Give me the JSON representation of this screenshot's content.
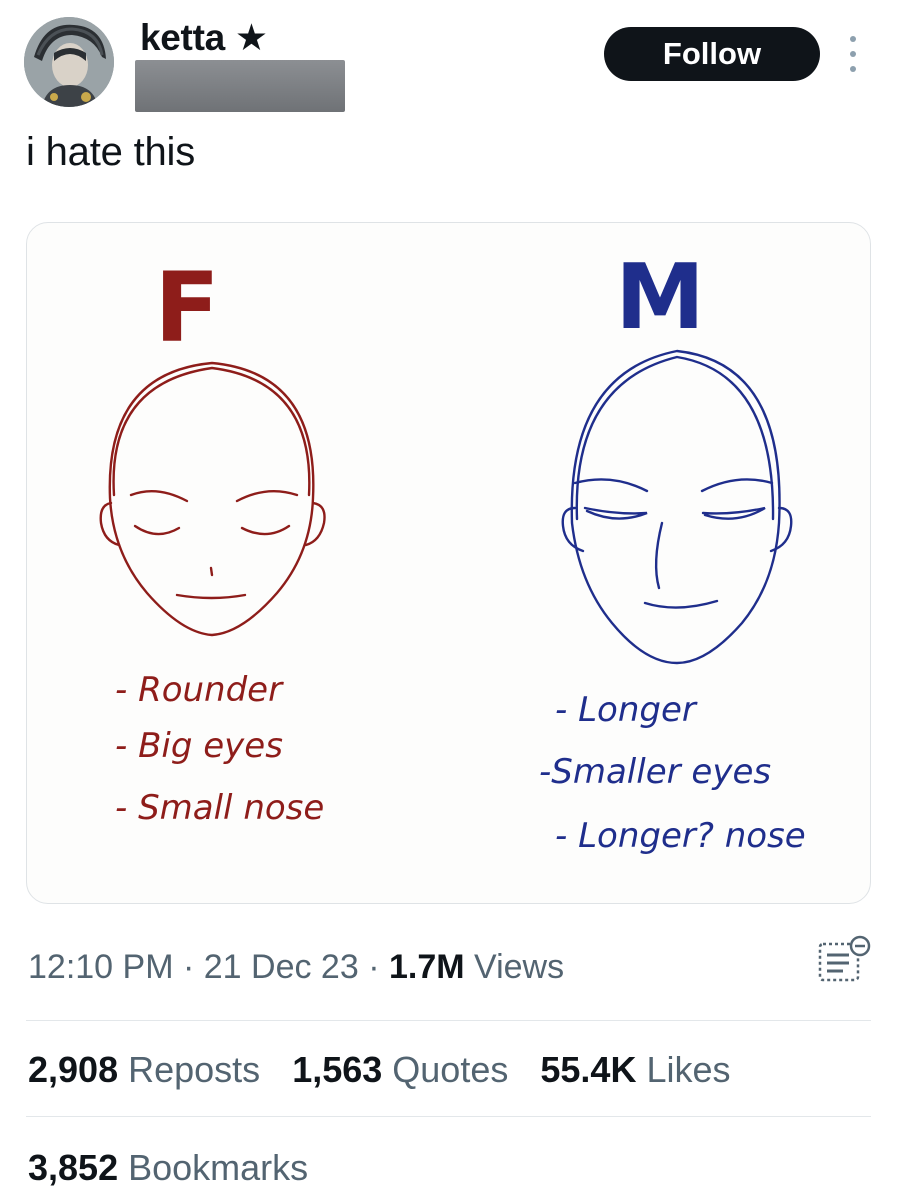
{
  "author": {
    "name": "ketta ★",
    "follow_label": "Follow"
  },
  "tweet": {
    "text": "i hate this"
  },
  "image": {
    "female": {
      "heading": "F",
      "color": "#8e1d1a",
      "notes": [
        "- Rounder",
        "- Big eyes",
        "- Small nose"
      ]
    },
    "male": {
      "heading": "M",
      "color": "#1f2e8c",
      "notes": [
        "- Longer",
        "-Smaller eyes",
        "- Longer? nose"
      ]
    }
  },
  "meta": {
    "time": "12:10 PM",
    "sep1": " · ",
    "date": "21 Dec 23",
    "sep2": " · ",
    "views_count": "1.7M",
    "views_label": " Views"
  },
  "stats": {
    "reposts": {
      "count": "2,908",
      "label": " Reposts"
    },
    "quotes": {
      "count": "1,563",
      "label": " Quotes"
    },
    "likes": {
      "count": "55.4K",
      "label": " Likes"
    },
    "bookmarks": {
      "count": "3,852",
      "label": " Bookmarks"
    }
  },
  "colors": {
    "text_primary": "#0f1419",
    "text_secondary": "#536471",
    "button_bg": "#0f1419",
    "divider": "#e3e7ea"
  },
  "icons": {
    "more": "vertical-dots-icon",
    "analytics": "analytics-icon"
  }
}
